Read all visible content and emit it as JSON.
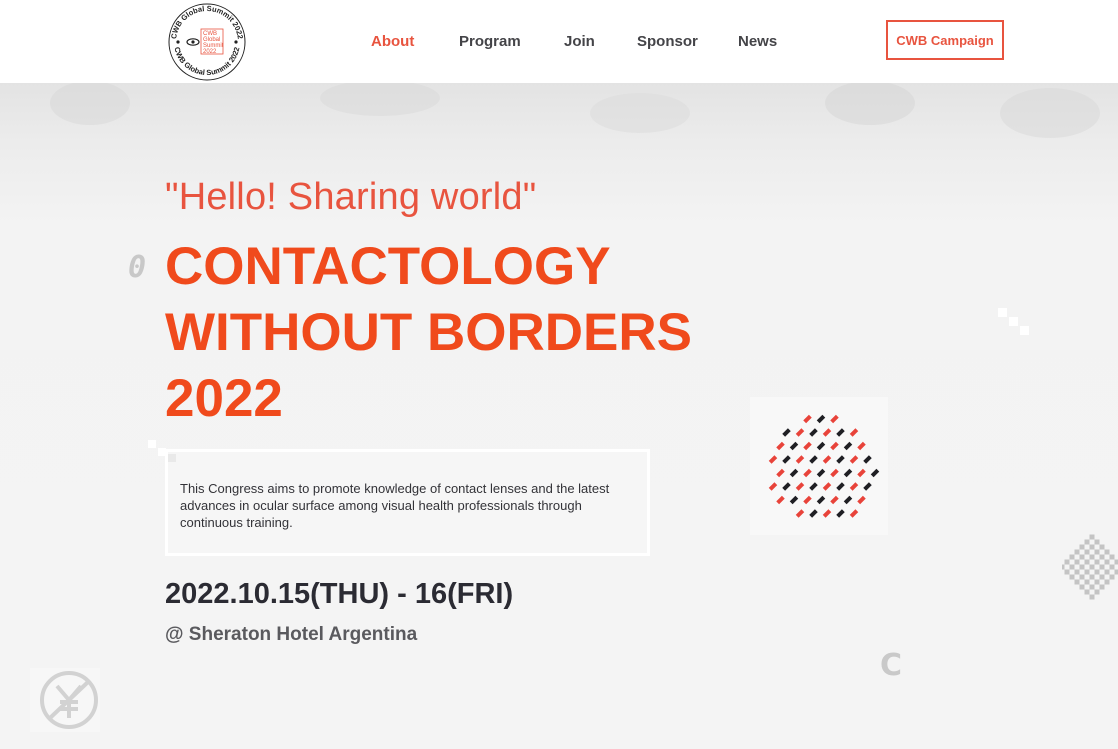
{
  "logo": {
    "ring_text": "CWB Global Summit 2022",
    "center_line1": "CWB",
    "center_line2": "Global",
    "center_line3": "Summit",
    "center_line4": "2022"
  },
  "nav": {
    "items": [
      {
        "label": "About",
        "active": true
      },
      {
        "label": "Program",
        "active": false
      },
      {
        "label": "Join",
        "active": false
      },
      {
        "label": "Sponsor",
        "active": false
      },
      {
        "label": "News",
        "active": false
      }
    ],
    "campaign_label": "CWB Campaign"
  },
  "hero": {
    "tagline": "\"Hello! Sharing world\"",
    "title_line1": "CONTACTOLOGY",
    "title_line2": "WITHOUT BORDERS",
    "title_line3": "2022",
    "description": "This Congress aims to promote knowledge of contact lenses and the latest advances in ocular surface among visual health professionals through continuous training.",
    "date": "2022.10.15(THU) - 16(FRI)",
    "venue": "@ Sheraton Hotel Argentina"
  },
  "deco_glyphs": {
    "zero": "0",
    "c": "C"
  },
  "colors": {
    "accent": "#e8543f",
    "title": "#f04a1c",
    "dark": "#2b2b33"
  }
}
